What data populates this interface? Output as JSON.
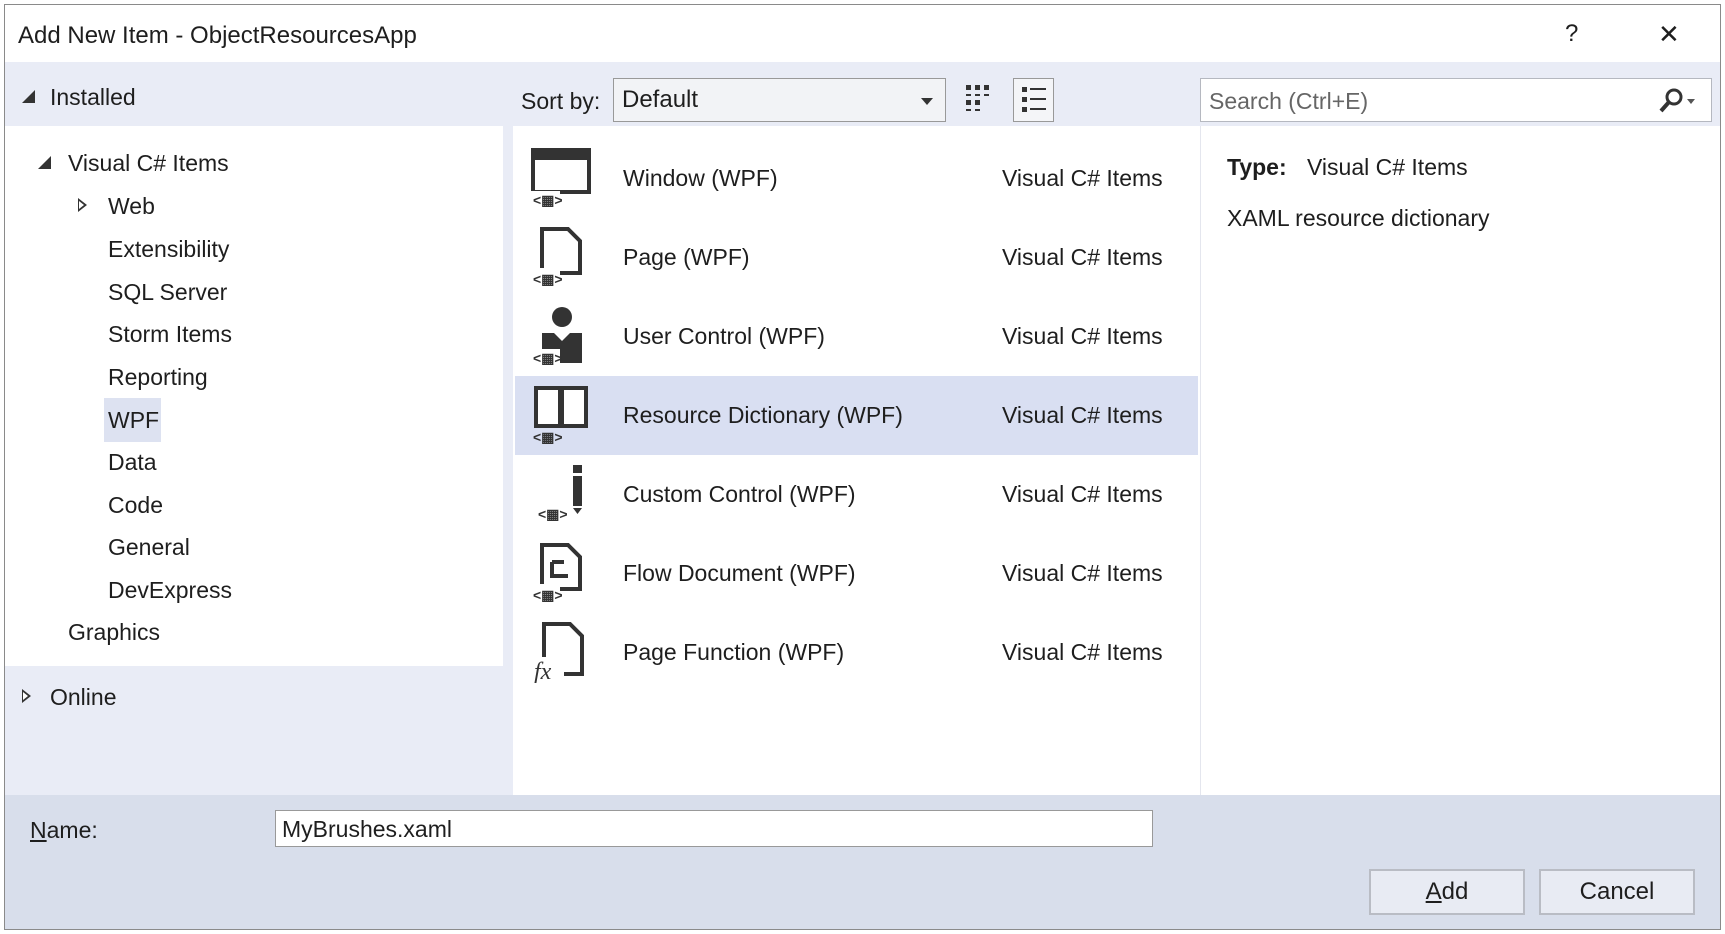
{
  "title": "Add New Item - ObjectResourcesApp",
  "titlebar": {
    "help": "?",
    "close": "✕"
  },
  "tree": {
    "installed": "Installed",
    "root": "Visual C# Items",
    "children": [
      "Web",
      "Extensibility",
      "SQL Server",
      "Storm Items",
      "Reporting",
      "WPF",
      "Data",
      "Code",
      "General",
      "DevExpress"
    ],
    "selected": "WPF",
    "graphics": "Graphics",
    "online": "Online"
  },
  "toolbar": {
    "sort_label": "Sort by:",
    "sort_value": "Default",
    "search_placeholder": "Search (Ctrl+E)"
  },
  "items": [
    {
      "name": "Window (WPF)",
      "type": "Visual C# Items",
      "icon": "window-icon"
    },
    {
      "name": "Page (WPF)",
      "type": "Visual C# Items",
      "icon": "page-icon"
    },
    {
      "name": "User Control (WPF)",
      "type": "Visual C# Items",
      "icon": "user-control-icon"
    },
    {
      "name": "Resource Dictionary (WPF)",
      "type": "Visual C# Items",
      "icon": "book-icon"
    },
    {
      "name": "Custom Control (WPF)",
      "type": "Visual C# Items",
      "icon": "custom-control-icon"
    },
    {
      "name": "Flow Document (WPF)",
      "type": "Visual C# Items",
      "icon": "flow-document-icon"
    },
    {
      "name": "Page Function (WPF)",
      "type": "Visual C# Items",
      "icon": "page-function-icon"
    }
  ],
  "details": {
    "type_label": "Type:",
    "type_value": "Visual C# Items",
    "description": "XAML resource dictionary"
  },
  "footer": {
    "name_label_u": "N",
    "name_label_rest": "ame:",
    "name_value": "MyBrushes.xaml",
    "add_u": "A",
    "add_rest": "dd",
    "cancel": "Cancel"
  },
  "colors": {
    "selection": "#d9dff2",
    "header": "#e9ecf6",
    "footer": "#d8deeb"
  }
}
